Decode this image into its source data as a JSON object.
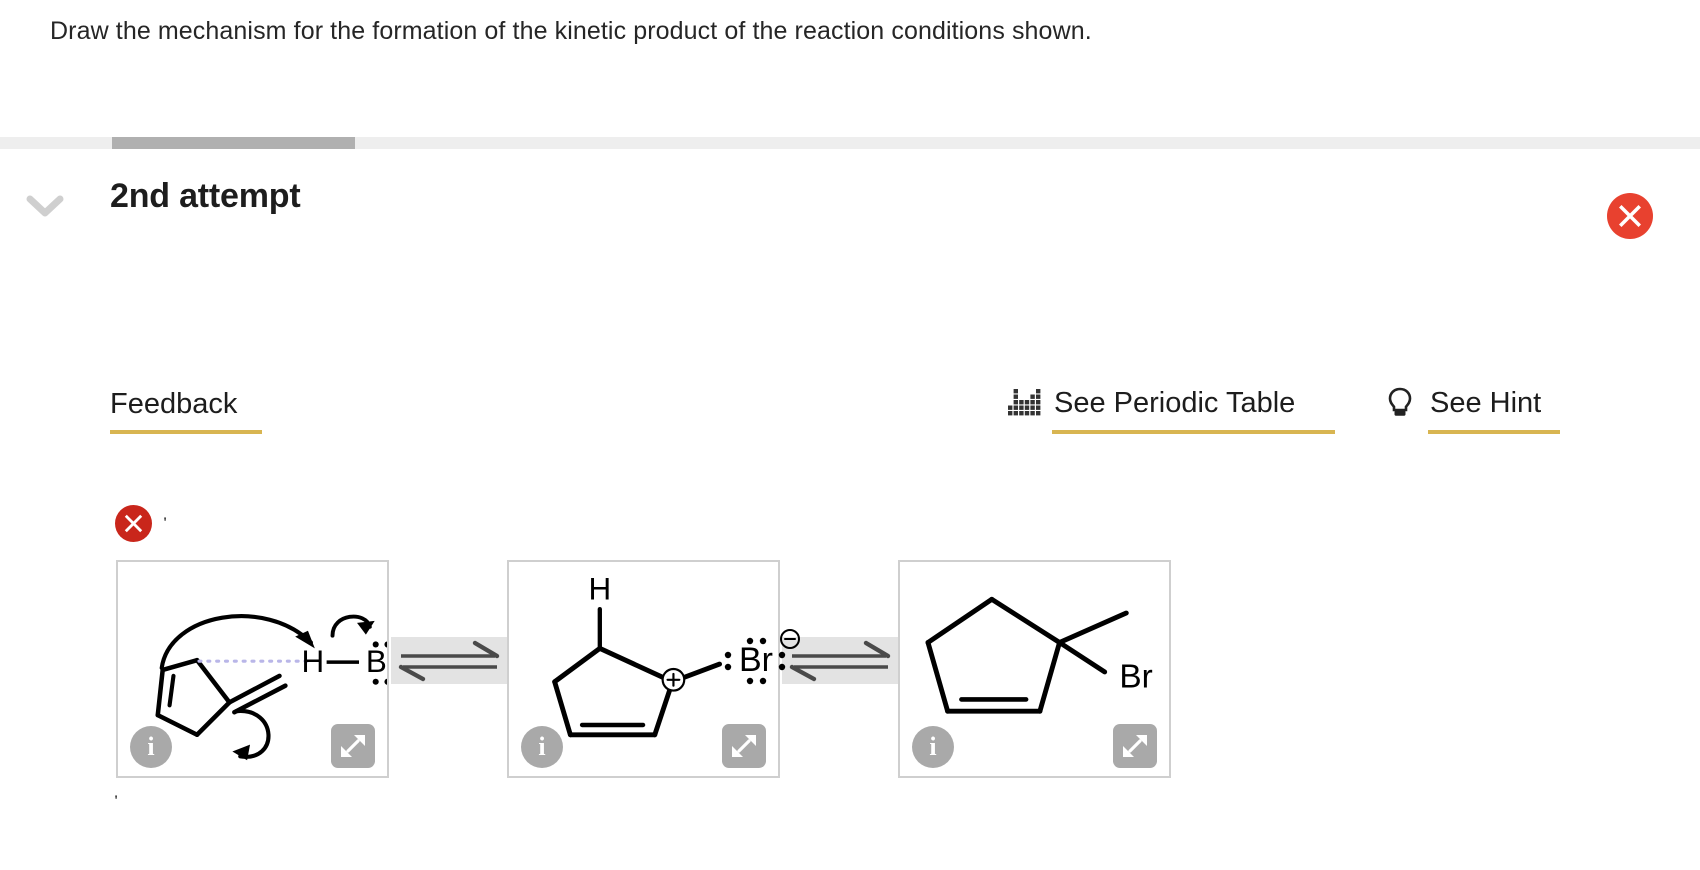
{
  "prompt": {
    "text": "Draw the mechanism for the formation of the kinetic product of the reaction conditions shown."
  },
  "attempt": {
    "title": "2nd attempt",
    "collapse_icon": "chevron-down-icon",
    "status_icon": "circle-x-icon",
    "status_color": "#e8412f",
    "progress_tab_color": "#b0b0b0"
  },
  "feedback": {
    "label": "Feedback",
    "underline_color": "#d8b551",
    "result_icon": "circle-x-icon",
    "result_color": "#c9261b",
    "marker_top": "'",
    "marker_bottom": "'"
  },
  "tools": {
    "periodic_table": {
      "label": "See Periodic Table",
      "icon": "periodic-table-icon"
    },
    "hint": {
      "label": "See Hint",
      "icon": "lightbulb-icon"
    }
  },
  "scheme": {
    "equilibrium_symbol": "⇌",
    "free_species": {
      "label": "Br",
      "charge": "⊖",
      "lone_pairs": 4
    },
    "steps": [
      {
        "id": "step-1",
        "name": "protonation-step",
        "atom_labels": [
          "H",
          "Br"
        ],
        "info_label": "i",
        "expand_label": "expand",
        "arrows": [
          "curved-arrow-alkene-to-H",
          "curved-arrow-HBr-to-Br",
          "curved-arrow-ring-shift"
        ]
      },
      {
        "id": "step-2",
        "name": "carbocation-intermediate",
        "atom_labels": [
          "H"
        ],
        "charge": "⊕",
        "info_label": "i",
        "expand_label": "expand"
      },
      {
        "id": "step-3",
        "name": "kinetic-product",
        "atom_labels": [
          "Br"
        ],
        "info_label": "i",
        "expand_label": "expand"
      }
    ]
  }
}
